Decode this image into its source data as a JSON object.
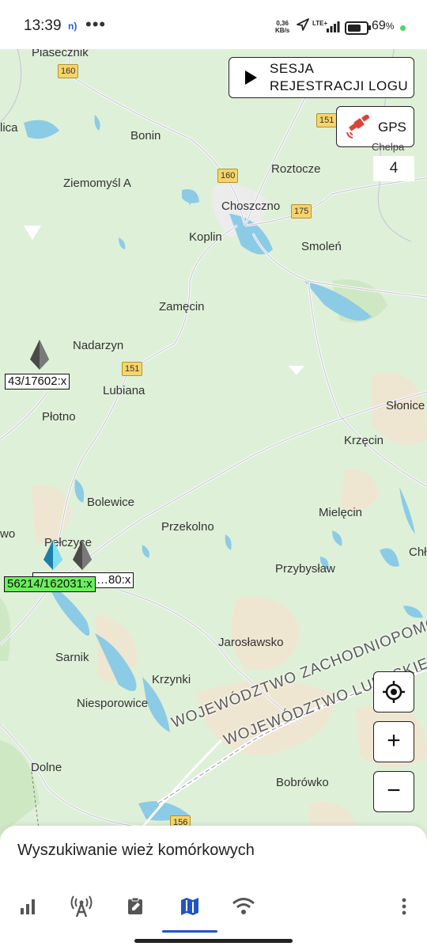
{
  "status_bar": {
    "time": "13:39",
    "nfc_label": "n)",
    "more_label": "•••",
    "speed_value": "0,36",
    "speed_unit": "KB/s",
    "network_label": "LTE+",
    "battery_percent": "69",
    "percent_sign": "%"
  },
  "map": {
    "places": [
      "Piasecznik",
      "lica",
      "Bonin",
      "Roztocze",
      "Ziemomyśl A",
      "Choszczno",
      "Koplin",
      "Smoleń",
      "Zamęcin",
      "Nadarzyn",
      "Lubiana",
      "Płotno",
      "Słonice",
      "Krzęcin",
      "Bolewice",
      "Mielęcin",
      "Przekolno",
      "wo",
      "Pełczyce",
      "Chł",
      "Przybysław",
      "Jarosławsko",
      "Sarnik",
      "Krzynki",
      "Niesporowice",
      "Dolne",
      "Bobrówko"
    ],
    "routes": [
      "160",
      "160",
      "151",
      "175",
      "151",
      "156"
    ],
    "region_labels": [
      "WOJEWÓDZTWO ZACHODNIOPOMORSKIE",
      "WOJEWÓDZTWO LUBUSKIE"
    ]
  },
  "overlay": {
    "session_button_line1": "SESJA",
    "session_button_line2": "REJESTRACJI LOGU",
    "gps_label": "GPS",
    "chelpa_label": "Chelpa",
    "chelpa_value": "4",
    "zoom_in_label": "+",
    "zoom_out_label": "−"
  },
  "towers": [
    {
      "label": "43/17602:x",
      "highlight": false
    },
    {
      "label": "56214/162031:x",
      "highlight": true
    },
    {
      "label": "…80:x",
      "highlight": false
    }
  ],
  "bottom_panel": {
    "title": "Wyszukiwanie wież komórkowych",
    "tabs": [
      "signal-bars-icon",
      "tower-icon",
      "notes-icon",
      "map-icon",
      "wifi-icon",
      "more-vert-icon"
    ],
    "active_tab": "map-icon"
  },
  "colors": {
    "accent": "#2255c4",
    "highlight_tag": "#6af05a",
    "map_land": "#dff0d8",
    "water": "#8ccbe6",
    "route_badge": "#f7d46a"
  }
}
